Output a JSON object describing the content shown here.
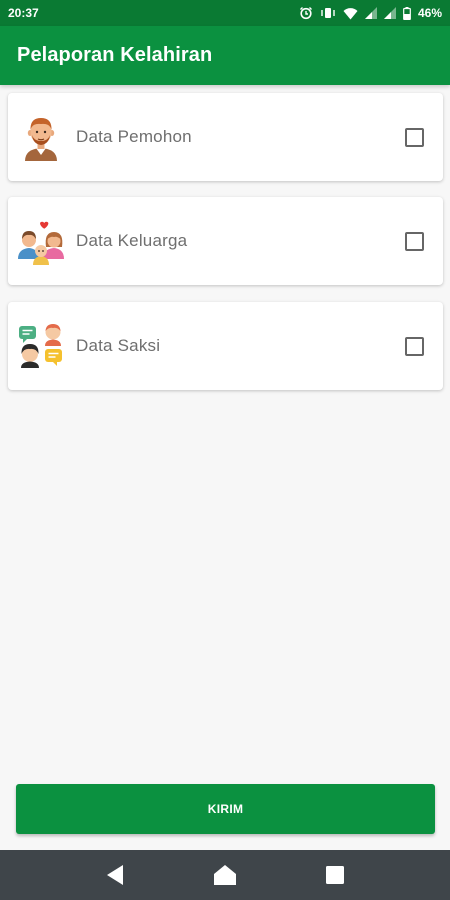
{
  "status_bar": {
    "time": "20:37",
    "battery": "46%",
    "icons": [
      "alarm-icon",
      "vibrate-icon",
      "wifi-icon",
      "signal-icon",
      "signal-icon",
      "battery-icon"
    ]
  },
  "app_bar": {
    "title": "Pelaporan Kelahiran",
    "color": "#0b9140"
  },
  "items": [
    {
      "label": "Data Pemohon",
      "icon": "man-avatar-icon",
      "checked": false
    },
    {
      "label": "Data Keluarga",
      "icon": "family-icon",
      "checked": false
    },
    {
      "label": "Data Saksi",
      "icon": "witnesses-chat-icon",
      "checked": false
    }
  ],
  "submit": {
    "label": "KIRIM"
  },
  "nav": {
    "icons": [
      "back-icon",
      "home-icon",
      "recents-icon"
    ]
  },
  "colors": {
    "primary": "#0b9140",
    "status_bar": "#0a7a33",
    "nav_bar": "#3f454a"
  }
}
